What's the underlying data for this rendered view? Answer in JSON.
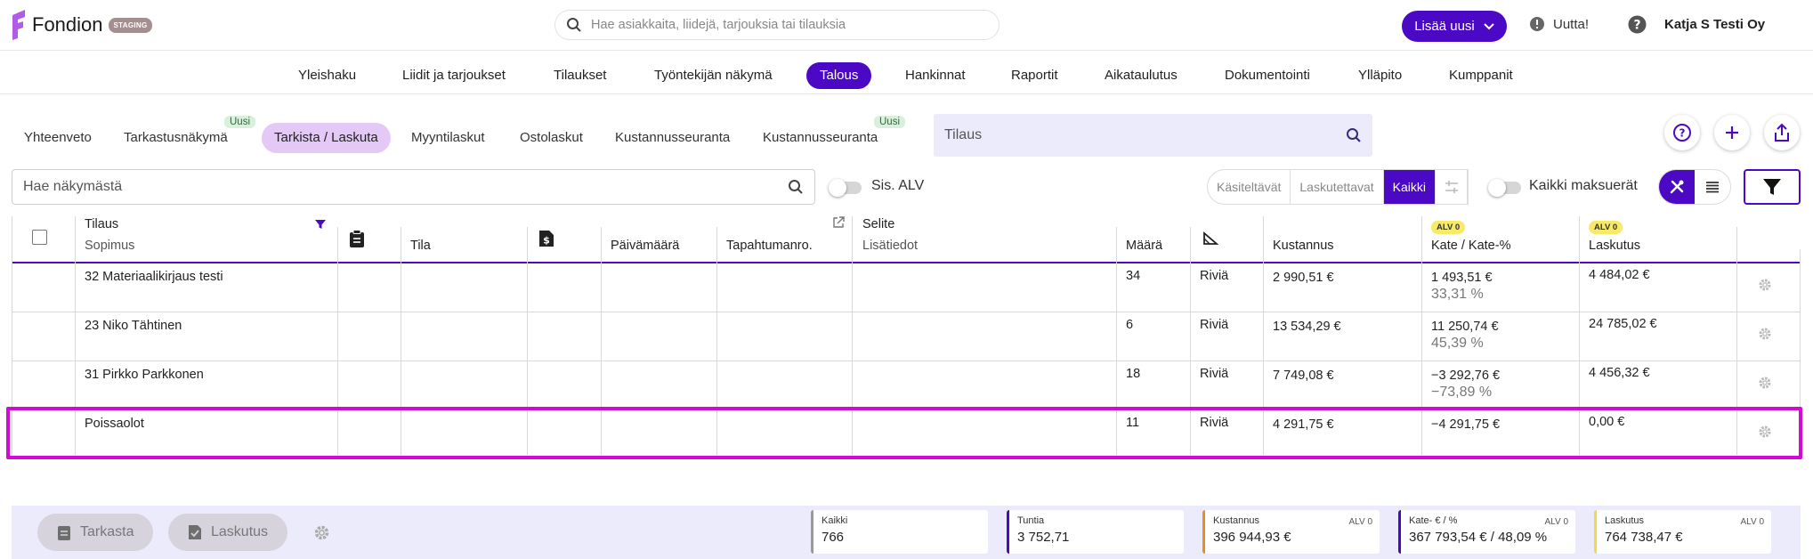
{
  "app": {
    "name": "Fondion",
    "env_badge": "STAGING",
    "search_placeholder": "Hae asiakkaita, liidejä, tarjouksia tai tilauksia",
    "add_new": "Lisää uusi",
    "whats_new": "Uutta!",
    "company": "Katja S Testi Oy"
  },
  "main_nav": [
    "Yleishaku",
    "Liidit ja tarjoukset",
    "Tilaukset",
    "Työntekijän näkymä",
    "Talous",
    "Hankinnat",
    "Raportit",
    "Aikataulutus",
    "Dokumentointi",
    "Ylläpito",
    "Kumppanit"
  ],
  "main_nav_active": "Talous",
  "sub_tabs": {
    "items": [
      "Yhteenveto",
      "Tarkastusnäkymä",
      "Tarkista / Laskuta",
      "Myyntilaskut",
      "Ostolaskut",
      "Kustannusseuranta",
      "Kustannusseuranta"
    ],
    "active": "Tarkista / Laskuta",
    "new_badge": "Uusi"
  },
  "order_search": {
    "placeholder": "Tilaus"
  },
  "filters": {
    "view_search_placeholder": "Hae näkymästä",
    "incl_vat": "Sis. ALV",
    "segments": [
      "Käsiteltävät",
      "Laskutettavat",
      "Kaikki"
    ],
    "segment_active": "Kaikki",
    "all_installments": "Kaikki maksuerät"
  },
  "table": {
    "headers": {
      "order": "Tilaus",
      "contract": "Sopimus",
      "status": "Tila",
      "date": "Päivämäärä",
      "event_no": "Tapahtumanro.",
      "description": "Selite",
      "extra_info": "Lisätiedot",
      "quantity": "Määrä",
      "cost": "Kustannus",
      "margin": "Kate / Kate-%",
      "billing": "Laskutus",
      "vat_badge": "ALV 0"
    },
    "rows": [
      {
        "order": "32 Materiaalikirjaus testi",
        "qty": "34",
        "unit": "Riviä",
        "cost": "2 990,51 €",
        "margin": "1 493,51 €",
        "margin_pct": "33,31 %",
        "billing": "4 484,02 €"
      },
      {
        "order": "23 Niko Tähtinen",
        "qty": "6",
        "unit": "Riviä",
        "cost": "13 534,29 €",
        "margin": "11 250,74 €",
        "margin_pct": "45,39 %",
        "billing": "24 785,02 €"
      },
      {
        "order": "31 Pirkko Parkkonen",
        "qty": "18",
        "unit": "Riviä",
        "cost": "7 749,08 €",
        "margin": "−3 292,76 €",
        "margin_pct": "−73,89 %",
        "billing": "4 456,32 €"
      },
      {
        "order": "Poissaolot",
        "qty": "11",
        "unit": "Riviä",
        "cost": "4 291,75 €",
        "margin": "−4 291,75 €",
        "margin_pct": "",
        "billing": "0,00 €"
      }
    ]
  },
  "footer": {
    "check_button": "Tarkasta",
    "billing_button": "Laskutus",
    "cards": [
      {
        "title": "Kaikki",
        "value": "766",
        "vat": "",
        "color": "#9a9a9a"
      },
      {
        "title": "Tuntia",
        "value": "3 752,71",
        "vat": "",
        "color": "#4b09c5"
      },
      {
        "title": "Kustannus",
        "value": "396 944,93 €",
        "vat": "ALV 0",
        "color": "#f08a1c"
      },
      {
        "title": "Kate- € / %",
        "value": "367 793,54 € / 48,09 %",
        "vat": "ALV 0",
        "color": "#4b09c5"
      },
      {
        "title": "Laskutus",
        "value": "764 738,47 €",
        "vat": "ALV 0",
        "color": "#f2d84a"
      }
    ]
  },
  "colors": {
    "accent": "#4b09c5",
    "highlight": "#d10ad6",
    "active_tab": "#e4c8f6",
    "panel": "#ecebfb"
  }
}
